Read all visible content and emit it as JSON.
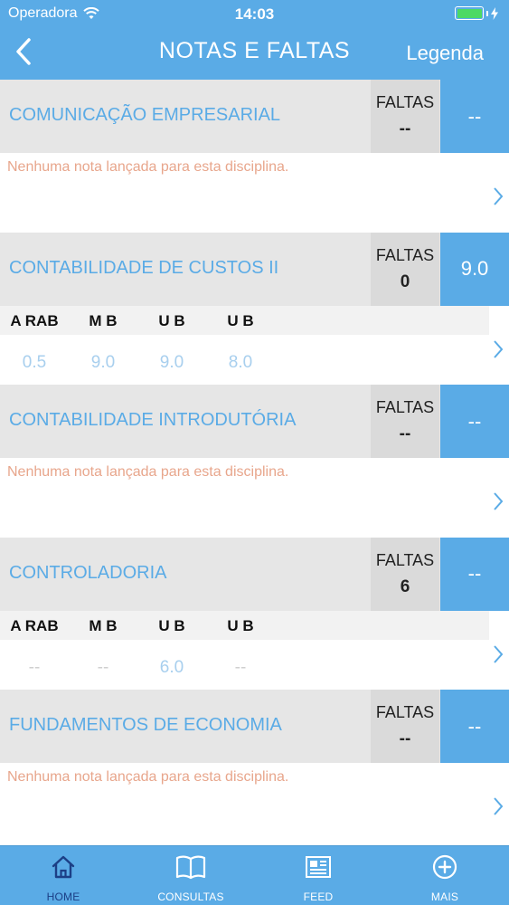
{
  "status_bar": {
    "carrier": "Operadora",
    "time": "14:03",
    "battery_color": "#4cd964"
  },
  "header": {
    "title": "NOTAS E FALTAS",
    "legend_label": "Legenda"
  },
  "colors": {
    "accent": "#5aabe6",
    "header_gray": "#e6e6e6",
    "no_grades_text": "#e8a68c",
    "active_tab": "#1c3f86"
  },
  "courses": [
    {
      "name": "COMUNICAÇÃO EMPRESARIAL",
      "faltas_label": "FALTAS",
      "faltas": "--",
      "media": "--",
      "message": "Nenhuma nota lançada para esta disciplina."
    },
    {
      "name": "CONTABILIDADE DE CUSTOS II",
      "faltas_label": "FALTAS",
      "faltas": "0",
      "media": "9.0",
      "grades": [
        {
          "label": "A RAB",
          "value": "0.5"
        },
        {
          "label": "M B",
          "value": "9.0"
        },
        {
          "label": "U B",
          "value": "9.0"
        },
        {
          "label": "U B",
          "value": "8.0"
        }
      ]
    },
    {
      "name": "CONTABILIDADE INTRODUTÓRIA",
      "faltas_label": "FALTAS",
      "faltas": "--",
      "media": "--",
      "message": "Nenhuma nota lançada para esta disciplina."
    },
    {
      "name": "CONTROLADORIA",
      "faltas_label": "FALTAS",
      "faltas": "6",
      "media": "--",
      "grades": [
        {
          "label": "A RAB",
          "value": "--"
        },
        {
          "label": "M B",
          "value": "--"
        },
        {
          "label": "U B",
          "value": "6.0"
        },
        {
          "label": "U B",
          "value": "--"
        }
      ]
    },
    {
      "name": "FUNDAMENTOS DE ECONOMIA",
      "faltas_label": "FALTAS",
      "faltas": "--",
      "media": "--",
      "message": "Nenhuma nota lançada para esta disciplina."
    }
  ],
  "tabs": [
    {
      "label": "HOME",
      "icon": "home-icon",
      "active": true
    },
    {
      "label": "CONSULTAS",
      "icon": "book-icon",
      "active": false
    },
    {
      "label": "FEED",
      "icon": "newspaper-icon",
      "active": false
    },
    {
      "label": "MAIS",
      "icon": "plus-circle-icon",
      "active": false
    }
  ]
}
